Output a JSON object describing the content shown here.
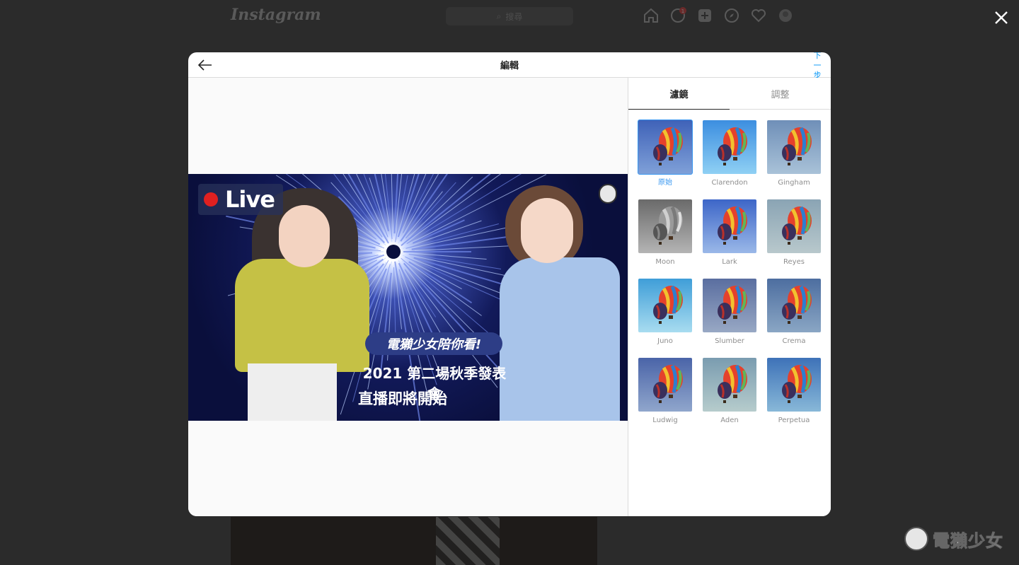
{
  "background": {
    "logo": "Instagram",
    "search_placeholder": "搜尋",
    "notification_count": "1"
  },
  "modal": {
    "title": "編輯",
    "next_label": "下一步",
    "tabs": [
      {
        "label": "濾鏡",
        "active": true
      },
      {
        "label": "調整",
        "active": false
      }
    ],
    "preview": {
      "live_label": "Live",
      "caption_pill": "電獺少女陪你看!",
      "caption_line1": "2021 第二場秋季發表會",
      "caption_line2": "直播即將開始"
    },
    "filters": [
      {
        "label": "原始",
        "selected": true,
        "sky": "#3f62b8",
        "sky2": "#7fa0d8",
        "gray": false
      },
      {
        "label": "Clarendon",
        "selected": false,
        "sky": "#3c8ee0",
        "sky2": "#8fd0f4",
        "gray": false
      },
      {
        "label": "Gingham",
        "selected": false,
        "sky": "#6f8fb8",
        "sky2": "#a9c2d8",
        "gray": false
      },
      {
        "label": "Moon",
        "selected": false,
        "sky": "#6a6a6a",
        "sky2": "#b4b4b4",
        "gray": true
      },
      {
        "label": "Lark",
        "selected": false,
        "sky": "#3d66c8",
        "sky2": "#9ab8e8",
        "gray": false
      },
      {
        "label": "Reyes",
        "selected": false,
        "sky": "#8aa4b4",
        "sky2": "#b8c8cc",
        "gray": false
      },
      {
        "label": "Juno",
        "selected": false,
        "sky": "#3f9ed8",
        "sky2": "#a8dcf0",
        "gray": false
      },
      {
        "label": "Slumber",
        "selected": false,
        "sky": "#5a6ea0",
        "sky2": "#98a8c4",
        "gray": false
      },
      {
        "label": "Crema",
        "selected": false,
        "sky": "#4d6ea0",
        "sky2": "#8aa6c4",
        "gray": false
      },
      {
        "label": "Ludwig",
        "selected": false,
        "sky": "#4a64a8",
        "sky2": "#90a6cc",
        "gray": false
      },
      {
        "label": "Aden",
        "selected": false,
        "sky": "#7a9cb0",
        "sky2": "#b6cccc",
        "gray": false
      },
      {
        "label": "Perpetua",
        "selected": false,
        "sky": "#3e72b8",
        "sky2": "#88b8d8",
        "gray": false
      }
    ]
  },
  "brand": {
    "label": "電獺少女"
  }
}
